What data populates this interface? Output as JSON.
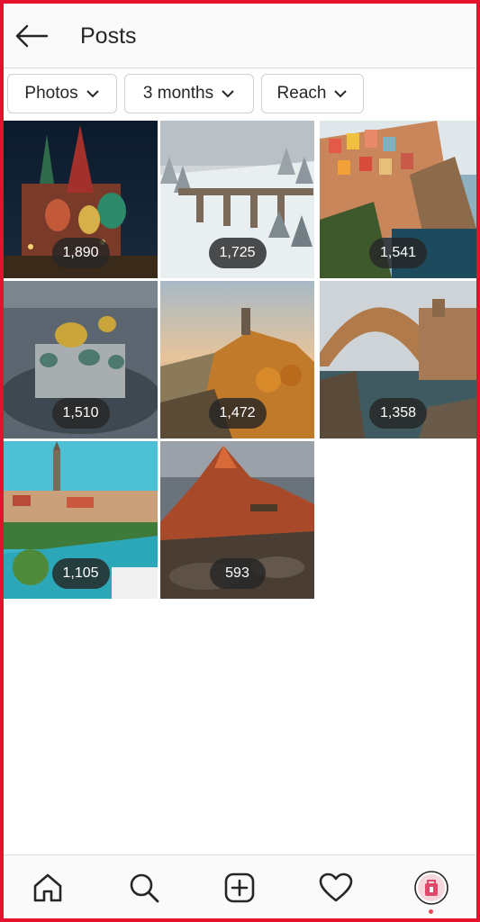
{
  "header": {
    "title": "Posts",
    "back_icon": "arrow-left-icon"
  },
  "filters": [
    {
      "label": "Photos",
      "icon": "chevron-down-icon"
    },
    {
      "label": "3 months",
      "icon": "chevron-down-icon"
    },
    {
      "label": "Reach",
      "icon": "chevron-down-icon"
    }
  ],
  "posts": [
    {
      "reach": "1,890",
      "subject": "St. Basil's Cathedral at night"
    },
    {
      "reach": "1,725",
      "subject": "snowy viaduct in forest"
    },
    {
      "reach": "1,541",
      "subject": "colorful cliffside village"
    },
    {
      "reach": "1,510",
      "subject": "domed cathedral aerial"
    },
    {
      "reach": "1,472",
      "subject": "hilltop tower at sunset"
    },
    {
      "reach": "1,358",
      "subject": "stone arch bridge"
    },
    {
      "reach": "1,105",
      "subject": "riverside town with spire"
    },
    {
      "reach": "593",
      "subject": "red mountain peak"
    }
  ],
  "bottom_nav": [
    {
      "icon": "home-icon"
    },
    {
      "icon": "search-icon"
    },
    {
      "icon": "add-post-icon"
    },
    {
      "icon": "heart-icon"
    },
    {
      "icon": "profile-avatar-icon"
    }
  ],
  "colors": {
    "frame": "#e3132d",
    "badge": "#262626",
    "accent": "#ed4956"
  }
}
